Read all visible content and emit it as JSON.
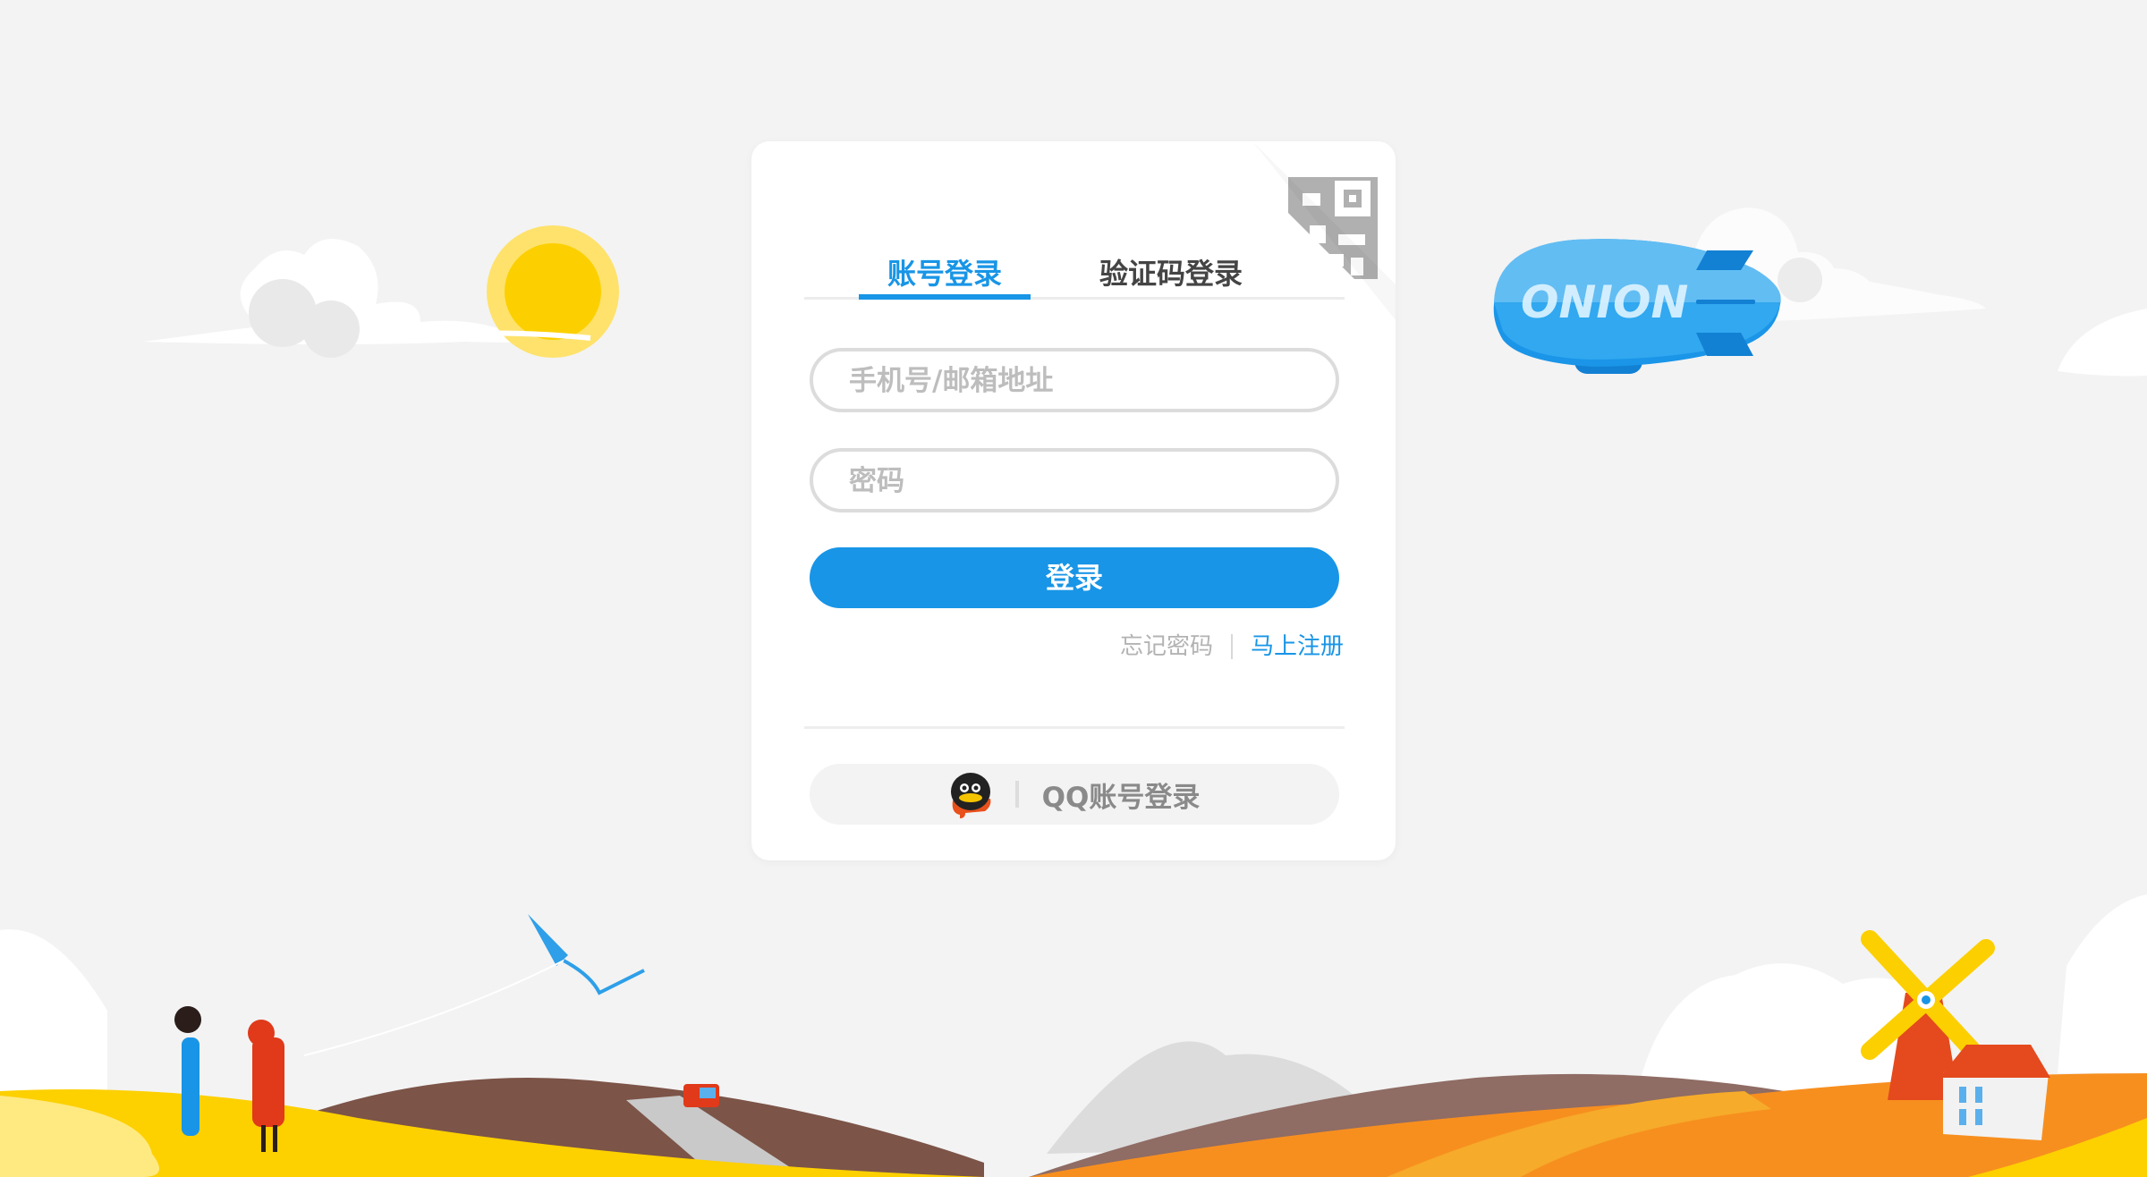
{
  "tabs": [
    {
      "label": "账号登录",
      "active": true
    },
    {
      "label": "验证码登录",
      "active": false
    }
  ],
  "form": {
    "account_placeholder": "手机号/邮箱地址",
    "account_value": "",
    "password_placeholder": "密码",
    "password_value": "",
    "login_label": "登录"
  },
  "links": {
    "forgot": "忘记密码",
    "register": "马上注册"
  },
  "qq": {
    "label": "QQ账号登录",
    "icon": "qq-penguin-icon"
  },
  "scene": {
    "blimp_text": "ONION"
  },
  "colors": {
    "accent": "#1895e6",
    "background": "#f3f3f3"
  }
}
